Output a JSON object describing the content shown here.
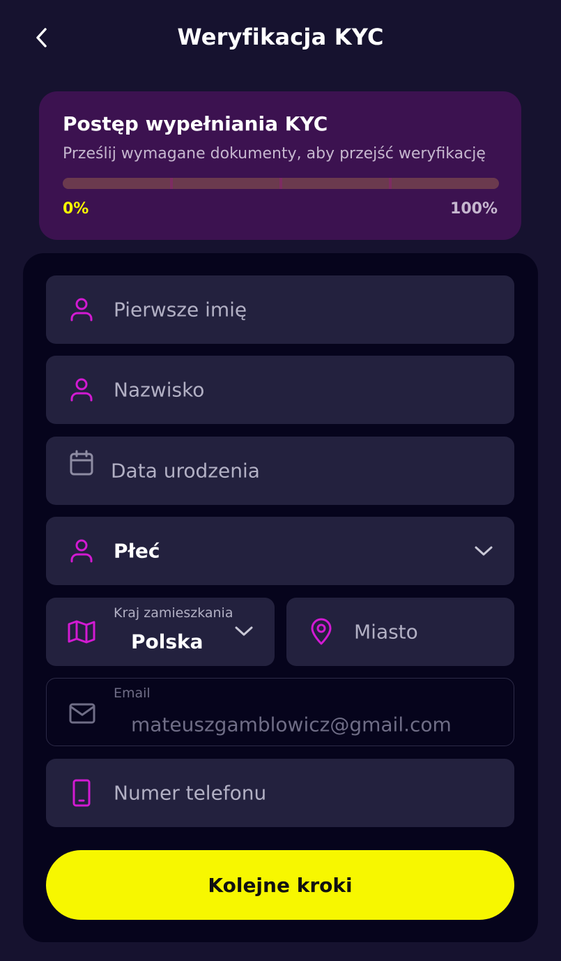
{
  "header": {
    "title": "Weryfikacja KYC"
  },
  "progress": {
    "title": "Postęp wypełniania KYC",
    "subtitle": "Prześlij wymagane dokumenty, aby przejść weryfikację",
    "value_percent": 0,
    "min_label": "0%",
    "max_label": "100%"
  },
  "form": {
    "first_name": {
      "placeholder": "Pierwsze imię",
      "icon": "user-icon"
    },
    "last_name": {
      "placeholder": "Nazwisko",
      "icon": "user-icon"
    },
    "birth_date": {
      "placeholder": "Data urodzenia",
      "icon": "calendar-icon"
    },
    "gender": {
      "value": "Płeć",
      "icon": "user-icon"
    },
    "country": {
      "label": "Kraj zamieszkania",
      "value": "Polska",
      "icon": "map-icon"
    },
    "city": {
      "placeholder": "Miasto",
      "icon": "location-pin-icon"
    },
    "email": {
      "label": "Email",
      "value": "mateuszgamblowicz@gmail.com",
      "icon": "mail-icon"
    },
    "phone": {
      "placeholder": "Numer telefonu",
      "icon": "phone-icon"
    }
  },
  "cta": {
    "label": "Kolejne kroki"
  },
  "colors": {
    "background": "#16122f",
    "panel": "#06041c",
    "field": "#23213e",
    "card": "#3c1250",
    "accent_yellow": "#f7f700",
    "icon_magenta": "#d21ad2"
  }
}
